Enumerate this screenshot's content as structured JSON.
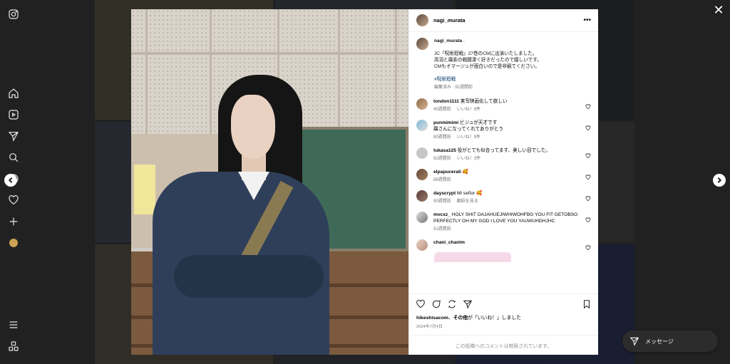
{
  "post": {
    "username": "nagi_murata",
    "caption_user": "nagi_murata",
    "caption_suffix": " .",
    "caption_lines": [
      "JC『呪術廻戦』27巻のCMに出演いたしました。",
      "高羽と羂索の戦闘凄く好きだったので嬉しいです。",
      "CMもオマージュが面白いので是非観てください。"
    ],
    "hashtag": "#呪術廻戦",
    "caption_meta": "編集済み · 92週間前",
    "likes_prefix": "hikeshisacom",
    "likes_middle": "、",
    "likes_bold2": "その他",
    "likes_suffix": "が「いいね！」しました",
    "date": "2024年7月4日",
    "restricted_text": "この投稿へのコメントは制限されています。"
  },
  "comments": [
    {
      "user": "tondon1111",
      "text": "実写映画化して欲しい",
      "time": "45週間前",
      "likes": "いいね！9件",
      "extra": ""
    },
    {
      "user": "punmimimi",
      "text": "ビジュが天才です",
      "text2": "羂さんになってくれてありがとう",
      "time": "80週間前",
      "likes": "いいね！9件",
      "extra": ""
    },
    {
      "user": "tukasa125",
      "text": "役がとても似合ってます、美しい目でした。",
      "time": "82週間前",
      "likes": "いいね！3件",
      "extra": ""
    },
    {
      "user": "elpapucerati",
      "text": "🥰",
      "time": "88週間前",
      "likes": "",
      "extra": ""
    },
    {
      "user": "dayscrypt",
      "text": "Mi señor 🥰",
      "time": "90週間前",
      "likes": "",
      "extra": "翻訳を見る"
    },
    {
      "user": "mvcxz_",
      "text": "HOLY SHIT OAJAHUEJIWHIWOHFBG YOU FIT GETOBSO PERFECTLY OH MY GOD I LOVE YOU YAUWUHDHJHC",
      "time": "91週間前",
      "likes": "",
      "extra": ""
    },
    {
      "user": "chani_chanim",
      "text": "",
      "time": "",
      "likes": "",
      "extra": ""
    }
  ],
  "message_label": "メッセージ"
}
